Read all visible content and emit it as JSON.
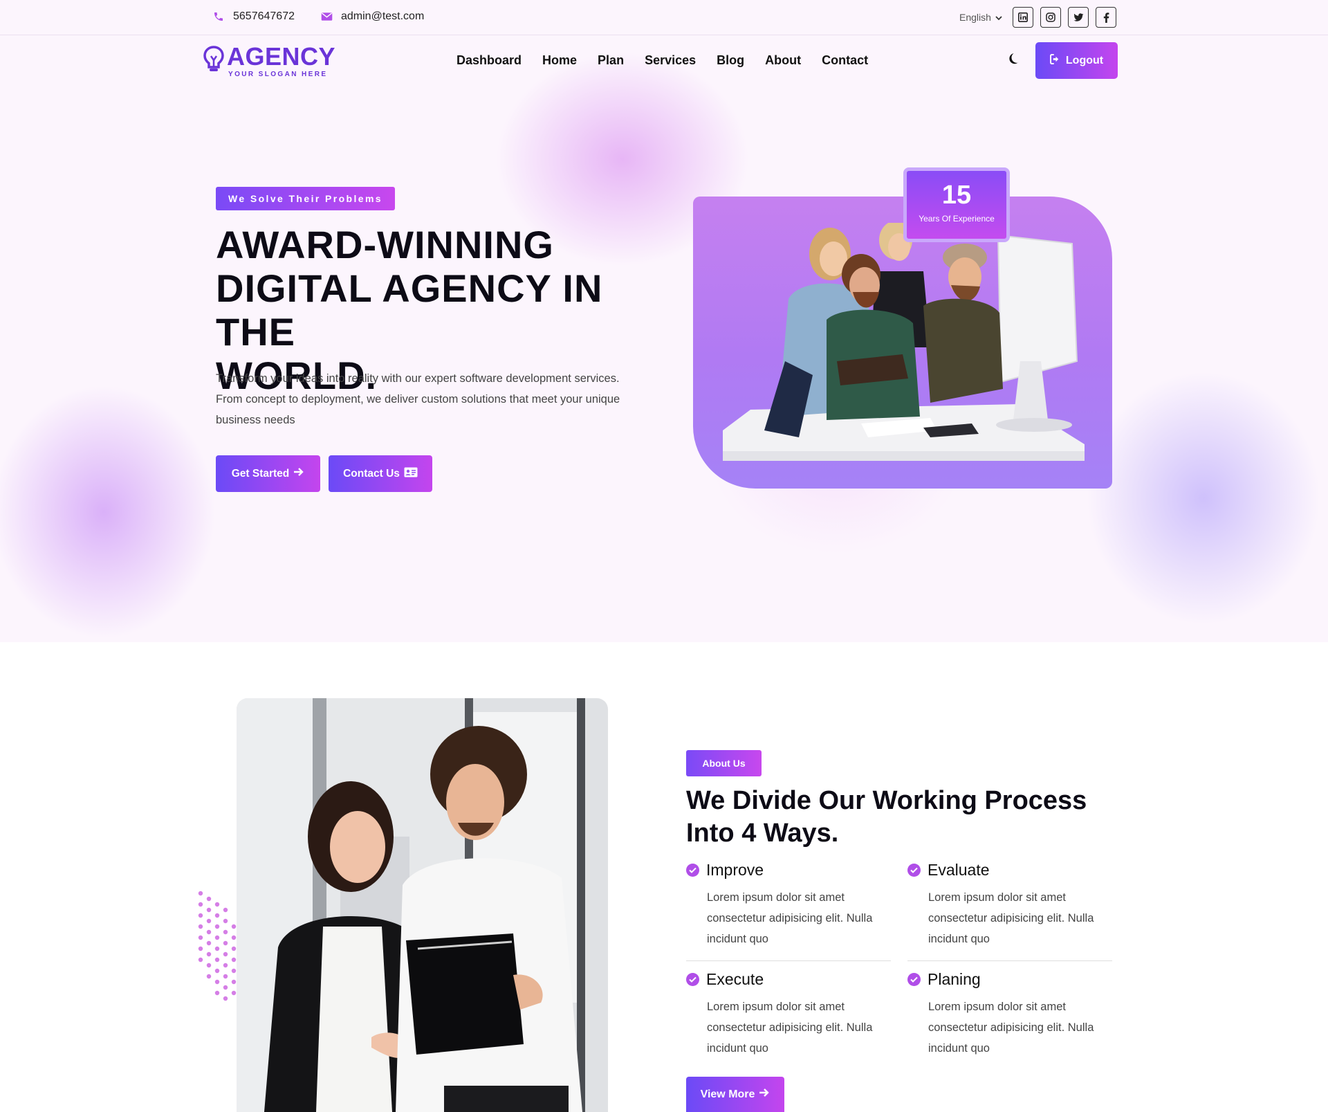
{
  "topbar": {
    "phone": "5657647672",
    "email": "admin@test.com",
    "language": "English",
    "social": [
      "linkedin-icon",
      "instagram-icon",
      "twitter-icon",
      "facebook-icon"
    ]
  },
  "logo": {
    "name": "AGENCY",
    "slogan": "YOUR SLOGAN HERE"
  },
  "nav": {
    "items": [
      "Dashboard",
      "Home",
      "Plan",
      "Services",
      "Blog",
      "About",
      "Contact"
    ]
  },
  "header": {
    "logout_label": "Logout"
  },
  "hero": {
    "badge": "We Solve Their Problems",
    "title_line1": "AWARD-WINNING",
    "title_line2": "DIGITAL AGENCY IN THE",
    "title_line3": "WORLD.",
    "text": "Transform your ideas into reality with our expert software development services. From concept to deployment, we deliver custom solutions that meet your unique business needs",
    "primary_button": "Get Started",
    "secondary_button": "Contact Us",
    "experience_number": "15",
    "experience_label": "Years Of Experience"
  },
  "about": {
    "badge": "About Us",
    "title_line1": "We Divide Our Working Process",
    "title_line2": "Into 4 Ways.",
    "features": [
      {
        "title": "Improve",
        "text": "Lorem ipsum dolor sit amet consectetur adipisicing elit. Nulla incidunt quo"
      },
      {
        "title": "Evaluate",
        "text": "Lorem ipsum dolor sit amet consectetur adipisicing elit. Nulla incidunt quo"
      },
      {
        "title": "Execute",
        "text": "Lorem ipsum dolor sit amet consectetur adipisicing elit. Nulla incidunt quo"
      },
      {
        "title": "Planing",
        "text": "Lorem ipsum dolor sit amet consectetur adipisicing elit. Nulla incidunt quo"
      }
    ],
    "view_more": "View More"
  },
  "colors": {
    "accent_start": "#6b4af6",
    "accent_end": "#c445ee",
    "brand": "#6a34d8"
  }
}
